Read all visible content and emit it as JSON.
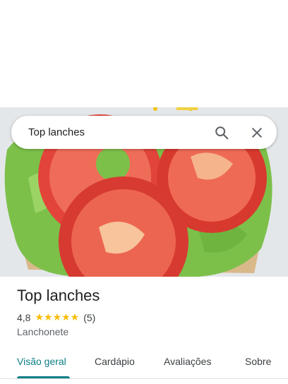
{
  "search": {
    "query": "Top lanches"
  },
  "place": {
    "name": "Top lanches",
    "rating": "4,8",
    "stars": "★★★★★",
    "star_count": 5,
    "review_count": "(5)",
    "category": "Lanchonete"
  },
  "tabs": [
    {
      "label": "Visão geral",
      "active": true
    },
    {
      "label": "Cardápio",
      "active": false
    },
    {
      "label": "Avaliações",
      "active": false
    },
    {
      "label": "Sobre",
      "active": false
    }
  ],
  "colors": {
    "accent": "#0b7f86",
    "star": "#fbbc04"
  }
}
